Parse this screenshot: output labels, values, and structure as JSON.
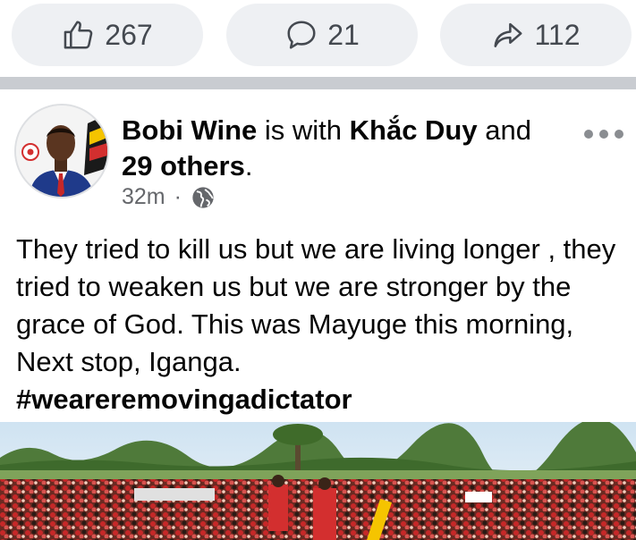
{
  "actions": {
    "likes": "267",
    "comments": "21",
    "shares": "112"
  },
  "post": {
    "author": "Bobi Wine",
    "with_text": " is with ",
    "tagged": "Khắc Duy",
    "and_text": " and ",
    "others": "29 others",
    "period": ".",
    "time": "32m",
    "separator": "·",
    "privacy_icon": "globe-icon",
    "body": "They tried to kill us but we are living longer , they tried to weaken us but we are stronger by the grace of God. This was Mayuge this morning, Next stop, Iganga.",
    "hashtag": "#weareremovingadictator"
  },
  "colors": {
    "pill_bg": "#eef0f3",
    "divider": "#c9ccd1",
    "secondary_text": "#65676b",
    "crowd_red": "#c62828"
  }
}
